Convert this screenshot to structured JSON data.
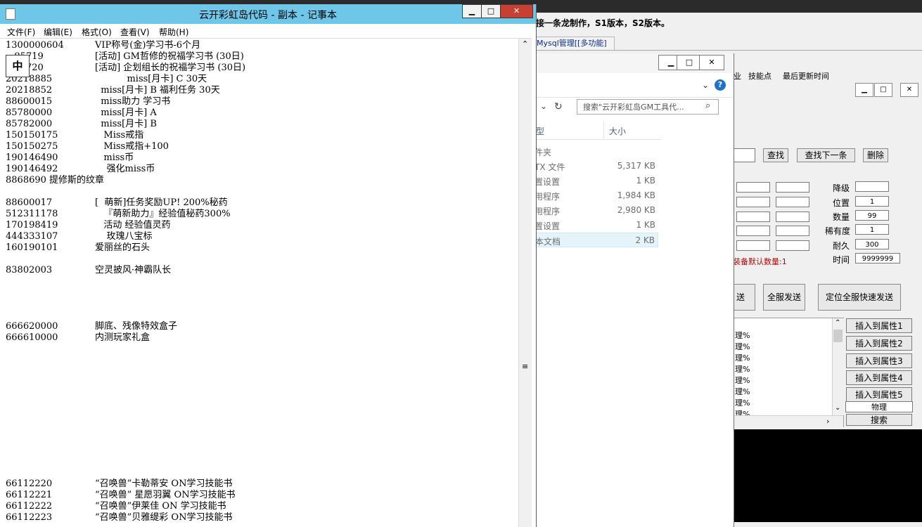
{
  "gm_tool": {
    "title": "接一条龙制作，S1版本，S2版本。",
    "mysql_tab": "Mysql管理[[多功能]",
    "header_cols": [
      "业",
      "技能点",
      "最后更新时间"
    ],
    "find_btn": "查找",
    "find_next_btn": "查找下一条",
    "delete_btn": "删除",
    "labels": {
      "downgrade": "降级",
      "position": "位置",
      "quantity": "数量",
      "rarity": "稀有度",
      "durability": "耐久",
      "time": "时间"
    },
    "values": {
      "position": "1",
      "quantity": "99",
      "rarity": "1",
      "durability": "300",
      "time": "9999999"
    },
    "red_note": "装备默认数量:1",
    "send_partial": "送",
    "send_all": "全服发送",
    "send_all_fast": "定位全服快速发送",
    "list_items": [
      "理%",
      "理%",
      "理%",
      "理%",
      "理%",
      "理%",
      "理%",
      "理%",
      "理%"
    ],
    "insert_buttons": [
      "插入到属性1",
      "插入到属性2",
      "插入到属性3",
      "插入到属性4",
      "插入到属性5"
    ],
    "physics_field": "物理",
    "search_btn": "搜索"
  },
  "explorer": {
    "search_placeholder": "搜索\"云开彩虹岛GM工具代...",
    "col_type": "型",
    "col_size": "大小",
    "rows": [
      {
        "type": "件夹",
        "size": ""
      },
      {
        "type": "TX 文件",
        "size": "5,317 KB"
      },
      {
        "type": "置设置",
        "size": "1 KB"
      },
      {
        "type": "用程序",
        "size": "1,984 KB"
      },
      {
        "type": "用程序",
        "size": "2,980 KB"
      },
      {
        "type": "置设置",
        "size": "1 KB"
      },
      {
        "type": "本文档",
        "size": "2 KB"
      }
    ]
  },
  "notepad": {
    "title": "云开彩虹岛代码 - 副本 - 记事本",
    "menu": [
      "文件(F)",
      "编辑(E)",
      "格式(O)",
      "查看(V)",
      "帮助(H)"
    ],
    "ime": "中",
    "lines": [
      {
        "id": "1300000604",
        "text": "VIP称号(金)学习书-6个月"
      },
      {
        "id": "   95719",
        "text": "[活动] GM哲修的祝福学习书 (30日)"
      },
      {
        "id": "   95720",
        "text": "[活动] 企划组长的祝福学习书 (30日)"
      },
      {
        "id": "20218885",
        "text": "           miss[月卡] C 30天"
      },
      {
        "id": "20218852",
        "text": "  miss[月卡] B 福利任务 30天"
      },
      {
        "id": "88600015",
        "text": "  miss助力 学习书"
      },
      {
        "id": "85780000",
        "text": "  miss[月卡] A"
      },
      {
        "id": "85782000",
        "text": "  miss[月卡] B"
      },
      {
        "id": "150150175",
        "text": "   Miss戒指"
      },
      {
        "id": "150150275",
        "text": "   Miss戒指+100"
      },
      {
        "id": "190146490",
        "text": "   miss币"
      },
      {
        "id": "190146492",
        "text": "    强化miss币"
      },
      {
        "id": "8868690",
        "text": "提修斯的纹章"
      },
      {
        "id": "",
        "text": ""
      },
      {
        "id": "88600017",
        "text": "[  萌新]任务奖励UP! 200%秘药"
      },
      {
        "id": "512311178",
        "text": "   『萌新助力』经验值秘药300%"
      },
      {
        "id": "170198419",
        "text": "   活动 经验值灵药"
      },
      {
        "id": "444333107",
        "text": "    玫瑰八宝标"
      },
      {
        "id": "160190101",
        "text": "爱丽丝的石头"
      },
      {
        "id": "",
        "text": ""
      },
      {
        "id": "83802003",
        "text": "空灵披风·神霸队长"
      },
      {
        "id": "",
        "text": ""
      },
      {
        "id": "",
        "text": ""
      },
      {
        "id": "",
        "text": ""
      },
      {
        "id": "",
        "text": ""
      },
      {
        "id": "666620000",
        "text": "脚底、残像特效盒子"
      },
      {
        "id": "666610000",
        "text": "内测玩家礼盒"
      },
      {
        "id": "66112220",
        "text": "“召唤兽”卡勒蒂安 ON学习技能书"
      },
      {
        "id": "66112221",
        "text": "“召唤兽” 星愿羽翼 ON学习技能书"
      },
      {
        "id": "66112222",
        "text": "“召唤兽”伊莱佳 ON 学习技能书"
      },
      {
        "id": "66112223",
        "text": "“召唤兽”贝雅缇彩 ON学习技能书"
      }
    ]
  }
}
